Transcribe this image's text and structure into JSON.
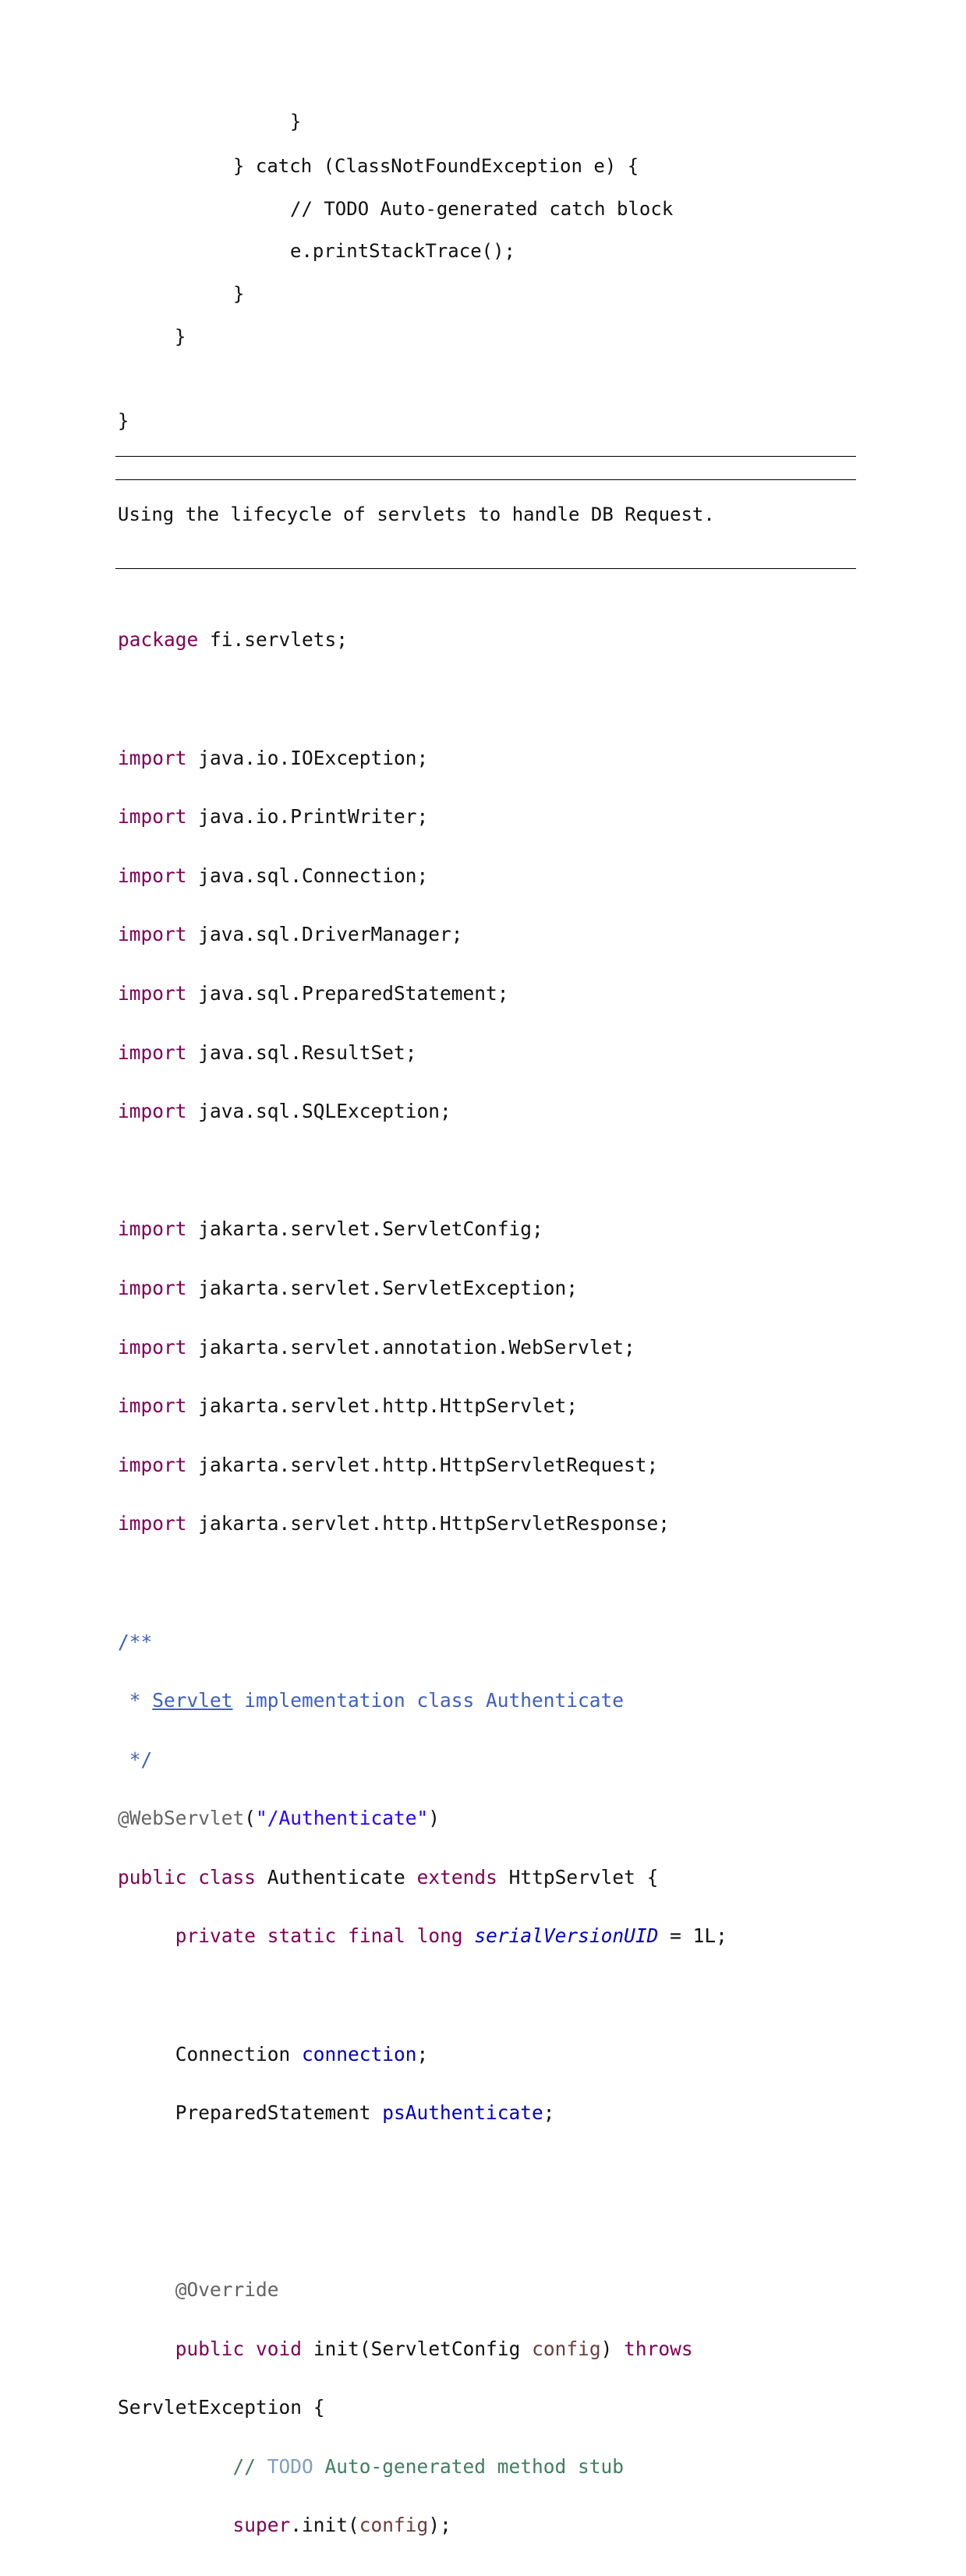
{
  "top_code": [
    "}",
    "} catch (ClassNotFoundException e) {",
    "// TODO Auto-generated catch block",
    "e.printStackTrace();",
    "}",
    "}",
    "}"
  ],
  "note": "Using the lifecycle of servlets to handle DB Request.",
  "listing": {
    "package_kw": "package",
    "package_name": " fi.servlets;",
    "import_kw": "import",
    "imports_java": [
      " java.io.IOException;",
      " java.io.PrintWriter;",
      " java.sql.Connection;",
      " java.sql.DriverManager;",
      " java.sql.PreparedStatement;",
      " java.sql.ResultSet;",
      " java.sql.SQLException;"
    ],
    "imports_jakarta": [
      " jakarta.servlet.ServletConfig;",
      " jakarta.servlet.ServletException;",
      " jakarta.servlet.annotation.WebServlet;",
      " jakarta.servlet.http.HttpServlet;",
      " jakarta.servlet.http.HttpServletRequest;",
      " jakarta.servlet.http.HttpServletResponse;"
    ],
    "doc_open": "/**",
    "doc_star": " * ",
    "doc_link": "Servlet",
    "doc_text": " implementation class Authenticate",
    "doc_close": " */",
    "annotation": "@WebServlet",
    "paren_open": "(",
    "annotation_value": "\"/Authenticate\"",
    "paren_close": ")",
    "kw_public": "public",
    "kw_class": "class",
    "class_name": " Authenticate ",
    "kw_extends": "extends",
    "class_super": " HttpServlet {",
    "kw_private": "private",
    "kw_static": "static",
    "kw_final": "final",
    "kw_long": "long",
    "serial_name": "serialVersionUID",
    "serial_value": " = 1L;",
    "conn_type": "Connection ",
    "conn_name": "connection",
    "ps_type": "PreparedStatement ",
    "ps_name": "psAuthenticate",
    "semicolon": ";",
    "override": "@Override",
    "kw_void": "void",
    "init_sig": " init(ServletConfig ",
    "init_param": "config",
    "init_close": ") ",
    "kw_throws": "throws",
    "throws_type": "ServletException {",
    "comment_slashes": "// ",
    "comment_todo": "TODO",
    "comment_text": " Auto-generated method stub",
    "kw_super": "super",
    "super_call": ".init(",
    "super_param": "config",
    "super_end": ");"
  }
}
